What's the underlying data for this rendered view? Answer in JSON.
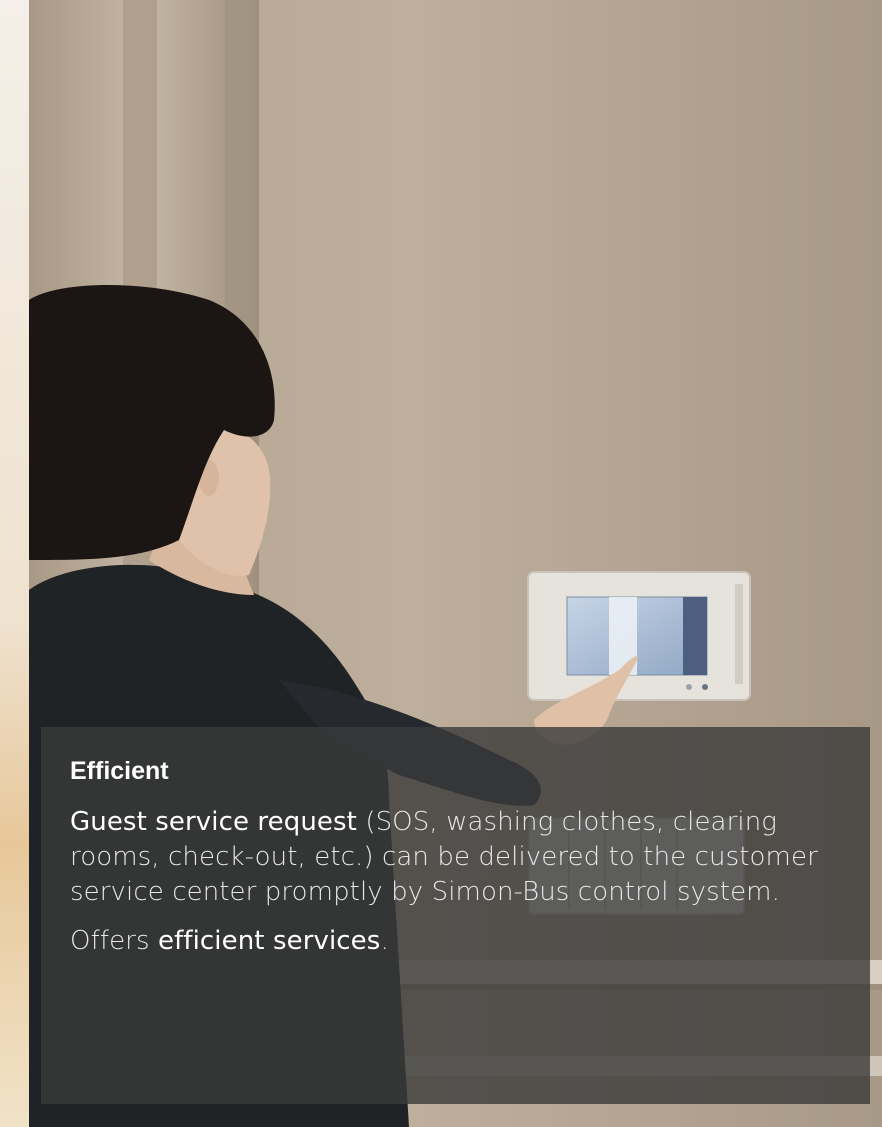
{
  "overlay": {
    "title": "Efficient",
    "paragraph1": {
      "highlight": "Guest service request",
      "rest": " (SOS, washing clothes, clearing rooms, check-out, etc.) can be delivered to the customer service center promptly by Simon-Bus control system."
    },
    "paragraph2": {
      "prefix": "Offers ",
      "highlight": "efficient services",
      "suffix": "."
    }
  },
  "colors": {
    "wall": "#b9a896",
    "overlay_bg": "#3a3a3a",
    "text_primary": "#ffffff",
    "text_secondary": "#e9e9e9"
  }
}
